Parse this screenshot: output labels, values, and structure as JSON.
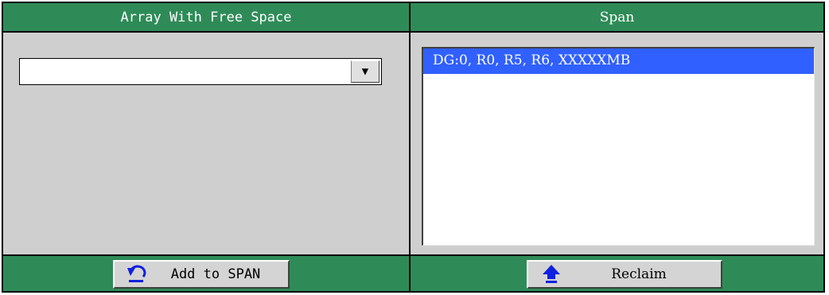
{
  "left_panel": {
    "title": "Array With Free Space",
    "combo": {
      "value": "",
      "dropdown_glyph": "▼"
    },
    "add_button_label": "Add to SPAN",
    "add_icon": "undo-arrow-icon"
  },
  "right_panel": {
    "title": "Span",
    "span_items": [
      "DG:0, R0, R5, R6, XXXXXMB"
    ],
    "reclaim_button_label": "Reclaim",
    "reclaim_icon": "up-arrow-icon"
  },
  "colors": {
    "header_green": "#2e8b57",
    "panel_gray": "#cfcfcf",
    "selection_blue": "#3060ff"
  }
}
